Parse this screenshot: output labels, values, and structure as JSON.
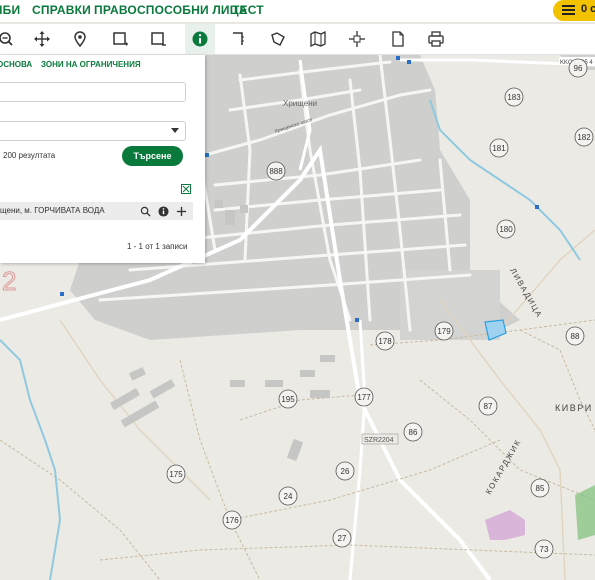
{
  "menu": [
    "ЛБИ",
    "СПРАВКИ",
    "ПРАВОСПОСОБНИ ЛИЦА",
    "ТЕСТ"
  ],
  "cart": {
    "count": "0 с"
  },
  "toolbar": {
    "tools": [
      "zoom-out-icon",
      "pan-icon",
      "location-pin-icon",
      "select-rect-icon",
      "select-rect-minus-icon",
      "info-icon",
      "measure-icon",
      "route-icon",
      "map-layers-icon",
      "crosshair-icon",
      "document-icon",
      "print-icon"
    ],
    "active_tool": "info-icon",
    "accent": "#0a7a3c"
  },
  "panel": {
    "tab_basis": "ОСНОВА",
    "tab_restrictions": "ЗОНИ НА ОГРАНИЧЕНИЯ",
    "result_limit": "200 резултата",
    "search_button": "Търсене",
    "result_text": "щени, м. ГОРЧИВАТА ВОДА",
    "pager": "1 - 1 от 1 записи"
  },
  "map": {
    "village": "Хрищени",
    "street_label": "Хрищенско шосе",
    "locality_kivri": "КИВРИ",
    "locality_livaditsa": "ЛИВАДИЦА",
    "locality_kokardzhik": "КОКАРДЖИК",
    "road_code": "SZR2204",
    "top_road_label": "KKO 2005 4",
    "big_number": "2",
    "block_numbers": [
      "96",
      "183",
      "182",
      "181",
      "888",
      "180",
      "88",
      "179",
      "178",
      "87",
      "195",
      "177",
      "86",
      "85",
      "175",
      "26",
      "24",
      "176",
      "27",
      "73"
    ],
    "colors": {
      "built_area": "#cfcfcd",
      "water": "#8fc9e0",
      "parcel": "#7ec8f0",
      "green_zone": "#7ec07a",
      "purple_zone": "#d9b6d9"
    }
  }
}
